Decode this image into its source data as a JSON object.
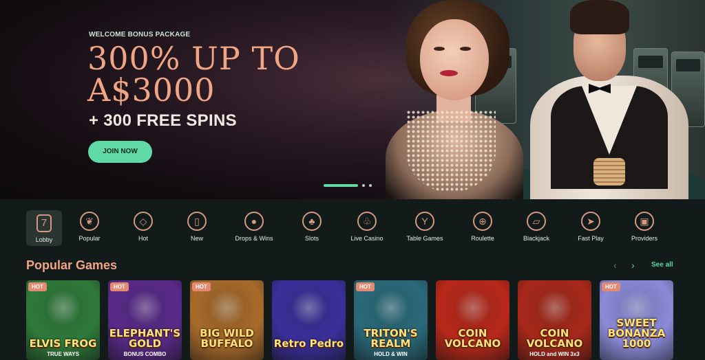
{
  "hero": {
    "eyebrow": "WELCOME BONUS PACKAGE",
    "title_line1": "300% UP TO",
    "title_line2": "A$3000",
    "subtitle": "+ 300 FREE SPINS",
    "cta_label": "JOIN NOW",
    "slider": {
      "total": 3,
      "active": 1
    }
  },
  "categories": [
    {
      "label": "Lobby",
      "icon": "seven-icon",
      "glyph": "7",
      "active": true
    },
    {
      "label": "Popular",
      "icon": "laurel-icon",
      "glyph": "❦"
    },
    {
      "label": "Hot",
      "icon": "diamond-icon",
      "glyph": "◇"
    },
    {
      "label": "New",
      "icon": "door-tag-icon",
      "glyph": "▯"
    },
    {
      "label": "Drops & Wins",
      "icon": "drops-wins-icon",
      "glyph": "●"
    },
    {
      "label": "Slots",
      "icon": "cherries-icon",
      "glyph": "♣"
    },
    {
      "label": "Live Casino",
      "icon": "club-icon",
      "glyph": "♧"
    },
    {
      "label": "Table Games",
      "icon": "cocktail-icon",
      "glyph": "Y"
    },
    {
      "label": "Roulette",
      "icon": "roulette-icon",
      "glyph": "⊕"
    },
    {
      "label": "Blackjack",
      "icon": "cards-icon",
      "glyph": "▱"
    },
    {
      "label": "Fast Play",
      "icon": "fast-play-icon",
      "glyph": "➤"
    },
    {
      "label": "Providers",
      "icon": "providers-icon",
      "glyph": "▣"
    }
  ],
  "popular": {
    "title": "Popular Games",
    "see_all": "See all",
    "prev_icon": "‹",
    "next_icon": "›",
    "games": [
      {
        "name": "ELVIS FROG",
        "sub": "TRUE WAYS",
        "badge": "HOT",
        "bg": "#2f7a3a"
      },
      {
        "name": "ELEPHANT'S GOLD",
        "sub": "BONUS COMBO",
        "badge": "HOT",
        "bg": "#5a2a8a"
      },
      {
        "name": "BIG WILD BUFFALO",
        "sub": "",
        "badge": "HOT",
        "bg": "#a86a2a"
      },
      {
        "name": "Retro Pedro",
        "sub": "",
        "badge": "",
        "bg": "#3a2f9a"
      },
      {
        "name": "TRITON'S REALM",
        "sub": "HOLD & WIN",
        "badge": "HOT",
        "bg": "#2a6a7a"
      },
      {
        "name": "COIN VOLCANO",
        "sub": "",
        "badge": "",
        "bg": "#b8281a"
      },
      {
        "name": "COIN VOLCANO",
        "sub": "HOLD and WIN 3x3",
        "badge": "",
        "bg": "#a8281a"
      },
      {
        "name": "SWEET BONANZA 1000",
        "sub": "",
        "badge": "HOT",
        "bg": "#8a8ad8"
      }
    ]
  }
}
